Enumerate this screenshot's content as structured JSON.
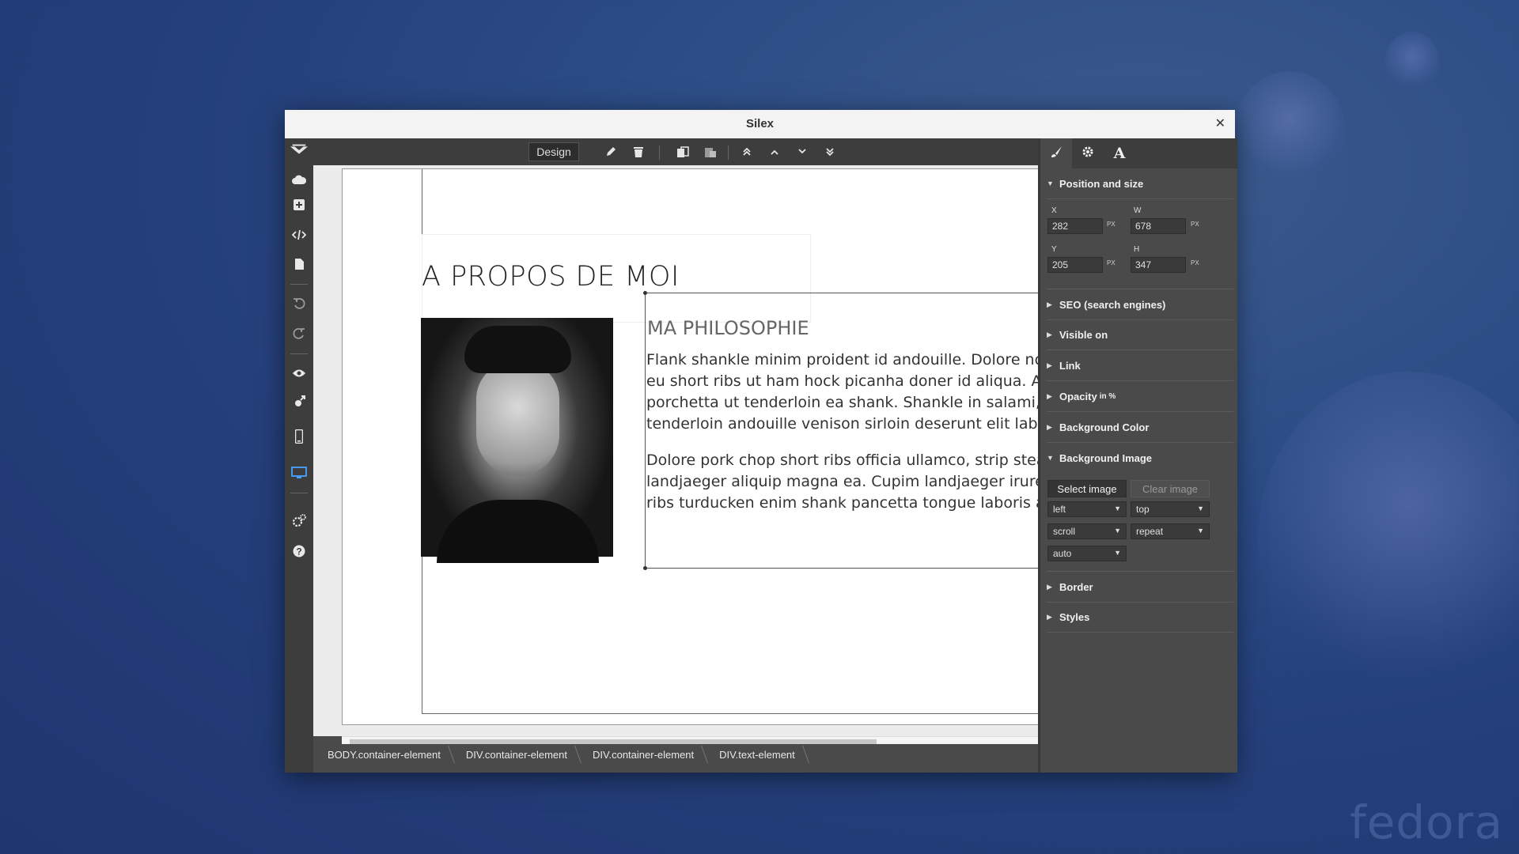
{
  "window": {
    "title": "Silex",
    "close_glyph": "✕"
  },
  "desktop": {
    "watermark": "fedora"
  },
  "toolbar": {
    "mode_label": "Design"
  },
  "canvas": {
    "page_title": "A PROPOS DE MOI",
    "subtitle": "MA PHILOSOPHIE",
    "para1": [
      "Flank shankle minim proident id andouille. Dolore nostrud",
      "eu short ribs ut ham hock picanha doner id aliqua. Aliqua",
      "porchetta ut tenderloin ea shank. Shankle in salami, paria",
      "tenderloin andouille venison sirloin deserunt elit labore d"
    ],
    "para2": [
      "Dolore pork chop short ribs officia ullamco, strip steak rep",
      "landjaeger aliquip magna ea. Cupim landjaeger irure bilto",
      "ribs turducken enim shank pancetta tongue laboris adipis"
    ]
  },
  "breadcrumb": [
    "BODY.container-element",
    "DIV.container-element",
    "DIV.container-element",
    "DIV.text-element"
  ],
  "panel": {
    "sections": {
      "position": "Position and size",
      "seo": "SEO (search engines)",
      "visible": "Visible on",
      "link": "Link",
      "opacity": "Opacity",
      "opacity_unit": "in %",
      "bgcolor": "Background Color",
      "bgimage": "Background Image",
      "border": "Border",
      "styles": "Styles"
    },
    "fields": {
      "x_label": "X",
      "x": "282",
      "w_label": "W",
      "w": "678",
      "y_label": "Y",
      "y": "205",
      "h_label": "H",
      "h": "347",
      "unit": "PX"
    },
    "bg_image": {
      "select_label": "Select image",
      "clear_label": "Clear image",
      "pos_x": "left",
      "pos_y": "top",
      "attachment": "scroll",
      "repeat": "repeat",
      "size": "auto"
    }
  },
  "icons": {
    "logo": "silex-logo-icon",
    "cloud": "cloud-icon",
    "add": "add-icon",
    "code": "code-icon",
    "page": "file-icon",
    "undo": "undo-icon",
    "redo": "redo-icon",
    "preview": "eye-icon",
    "publish": "publish-icon",
    "mobile": "mobile-icon",
    "desktop": "desktop-icon",
    "settings": "settings-icon",
    "help": "help-icon"
  },
  "colors": {
    "panel_bg": "#4a4a4a",
    "toolbar_bg": "#3d3d3d",
    "active_icon": "#4aa3ff"
  }
}
